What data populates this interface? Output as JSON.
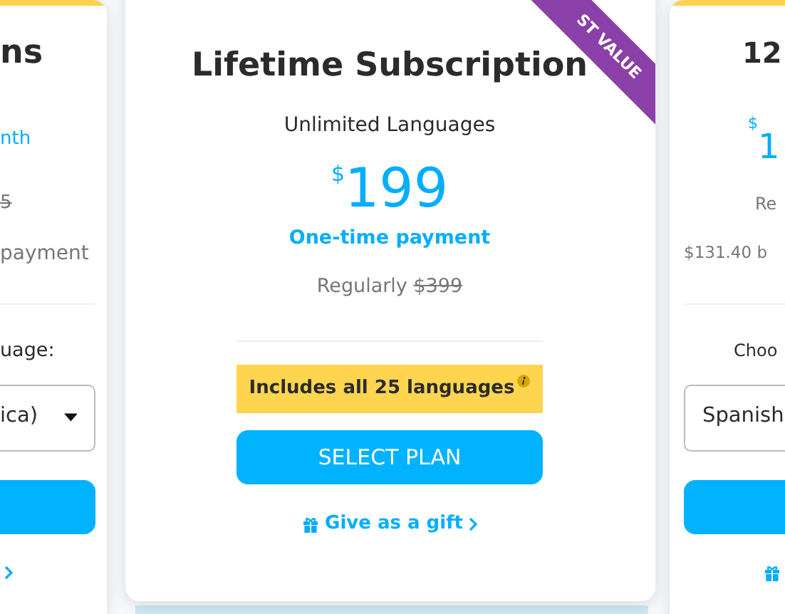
{
  "cards": [
    {
      "kind": "side",
      "items": [
        {
          "kind": "title",
          "text": "ns"
        },
        {
          "kind": "period",
          "text": "nth"
        },
        {
          "kind": "regular",
          "text": "5",
          "struck": true
        },
        {
          "kind": "note",
          "text": "payment"
        },
        {
          "kind": "divider"
        },
        {
          "kind": "label",
          "text": "uage:"
        },
        {
          "kind": "select",
          "value": "ica)"
        },
        {
          "kind": "button"
        },
        {
          "kind": "gift"
        }
      ]
    },
    {
      "kind": "featured",
      "ribbon": "ST VALUE",
      "title": "Lifetime Subscription",
      "subtitle": "Unlimited Languages",
      "currency": "$",
      "price": "199",
      "period": "One-time payment",
      "regular_label": "Regularly",
      "regular_price": "$399",
      "highlight": "Includes all 25 languages",
      "button": "SELECT PLAN",
      "gift": "Give as a gift"
    },
    {
      "kind": "side",
      "items": [
        {
          "kind": "title",
          "text": "12"
        },
        {
          "kind": "price",
          "currency": "$",
          "text": "1"
        },
        {
          "kind": "regular",
          "text": "Re"
        },
        {
          "kind": "note",
          "text": "$131.40 b"
        },
        {
          "kind": "divider"
        },
        {
          "kind": "label",
          "text": "Choo"
        },
        {
          "kind": "select",
          "value": "Spanish"
        },
        {
          "kind": "button"
        },
        {
          "kind": "gift"
        }
      ]
    }
  ]
}
